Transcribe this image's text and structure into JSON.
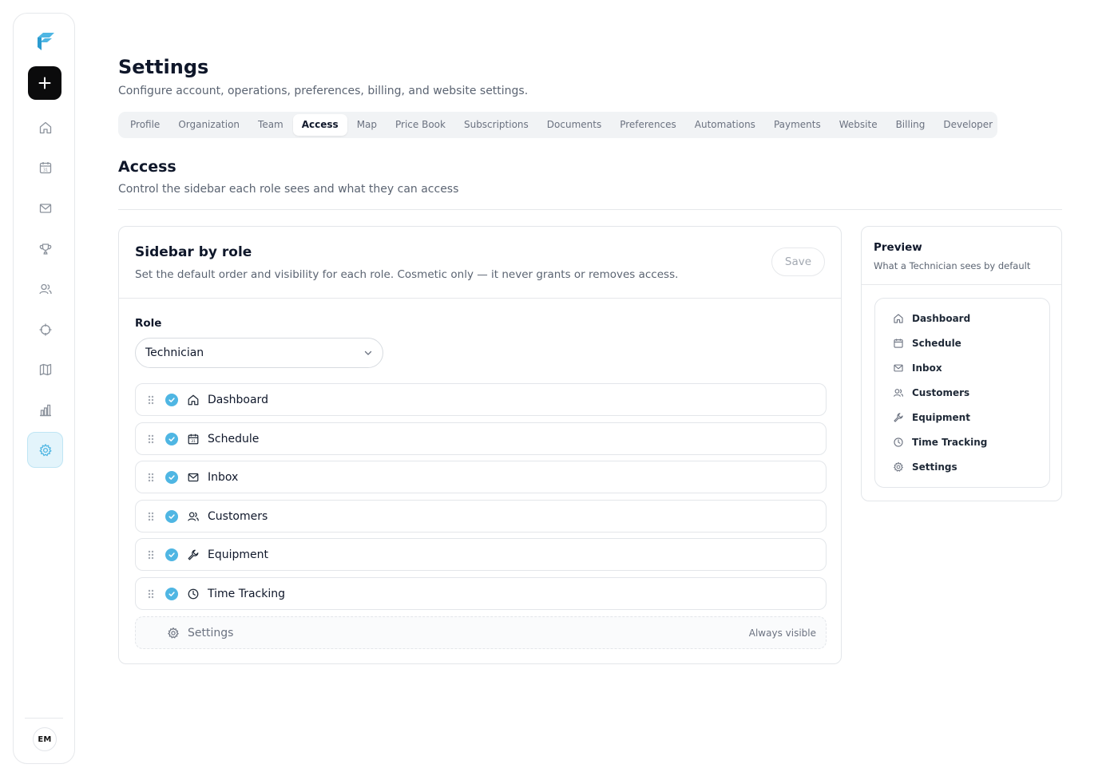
{
  "app": {
    "avatar_initials": "EM",
    "accent_color": "#4fb6e3"
  },
  "rail": {
    "nav": [
      "home-icon",
      "calendar-icon",
      "mail-icon",
      "trophy-icon",
      "users-icon",
      "crosshair-icon",
      "map-icon",
      "bar-chart-icon",
      "gear-icon"
    ],
    "active": "gear-icon"
  },
  "header": {
    "title": "Settings",
    "subtitle": "Configure account, operations, preferences, billing, and website settings."
  },
  "tabs": [
    {
      "label": "Profile"
    },
    {
      "label": "Organization"
    },
    {
      "label": "Team"
    },
    {
      "label": "Access",
      "active": true
    },
    {
      "label": "Map"
    },
    {
      "label": "Price Book"
    },
    {
      "label": "Subscriptions"
    },
    {
      "label": "Documents"
    },
    {
      "label": "Preferences"
    },
    {
      "label": "Automations"
    },
    {
      "label": "Payments"
    },
    {
      "label": "Website"
    },
    {
      "label": "Billing"
    },
    {
      "label": "Developer"
    }
  ],
  "section": {
    "title": "Access",
    "subtitle": "Control the sidebar each role sees and what they can access"
  },
  "sidebar_card": {
    "title": "Sidebar by role",
    "description": "Set the default order and visibility for each role. Cosmetic only — it never grants or removes access.",
    "save_label": "Save",
    "role_label": "Role",
    "role_value": "Technician",
    "items": [
      {
        "label": "Dashboard",
        "icon": "home-icon",
        "checked": true
      },
      {
        "label": "Schedule",
        "icon": "calendar-icon",
        "checked": true
      },
      {
        "label": "Inbox",
        "icon": "mail-icon",
        "checked": true
      },
      {
        "label": "Customers",
        "icon": "users-icon",
        "checked": true
      },
      {
        "label": "Equipment",
        "icon": "wrench-icon",
        "checked": true
      },
      {
        "label": "Time Tracking",
        "icon": "clock-icon",
        "checked": true
      }
    ],
    "locked_item": {
      "label": "Settings",
      "icon": "gear-icon",
      "note": "Always visible"
    }
  },
  "preview": {
    "title": "Preview",
    "subtitle": "What a Technician sees by default",
    "items": [
      {
        "label": "Dashboard",
        "icon": "home-icon"
      },
      {
        "label": "Schedule",
        "icon": "calendar-icon"
      },
      {
        "label": "Inbox",
        "icon": "mail-icon"
      },
      {
        "label": "Customers",
        "icon": "users-icon"
      },
      {
        "label": "Equipment",
        "icon": "wrench-icon"
      },
      {
        "label": "Time Tracking",
        "icon": "clock-icon"
      },
      {
        "label": "Settings",
        "icon": "gear-icon"
      }
    ]
  }
}
